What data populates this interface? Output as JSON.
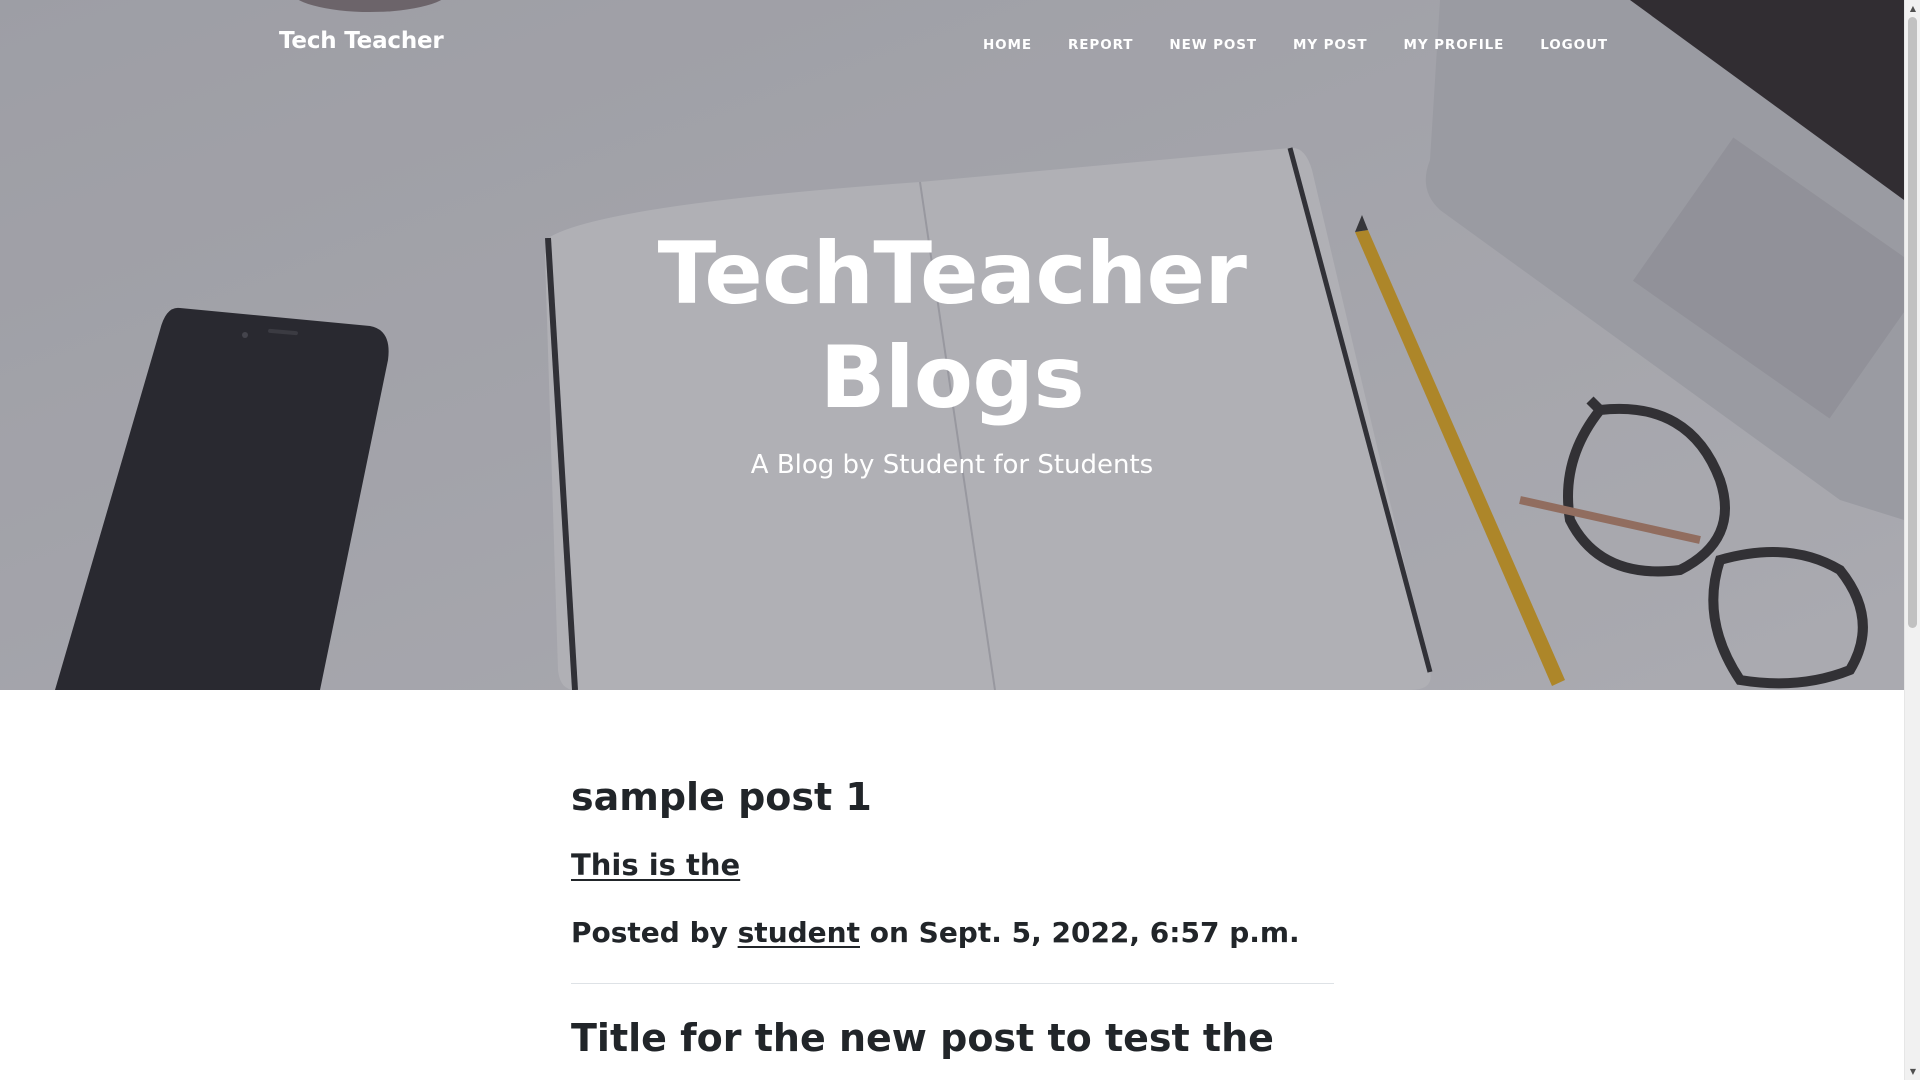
{
  "navbar": {
    "brand": "Tech Teacher",
    "links": [
      "HOME",
      "REPORT",
      "NEW POST",
      "MY POST",
      "MY PROFILE",
      "LOGOUT"
    ]
  },
  "hero": {
    "title_line1": "TechTeacher",
    "title_line2": "Blogs",
    "subheading": "A Blog by Student for Students"
  },
  "posts": [
    {
      "title": "sample post 1",
      "subtitle": "This is the",
      "meta_prefix": "Posted by",
      "author": "student",
      "meta_suffix": "on Sept. 5, 2022, 6:57 p.m."
    },
    {
      "title": "Title for the new post to test the"
    }
  ],
  "colors": {
    "text": "#212529",
    "hero_overlay": "#3c3c48",
    "divider": "#dee2e6"
  }
}
